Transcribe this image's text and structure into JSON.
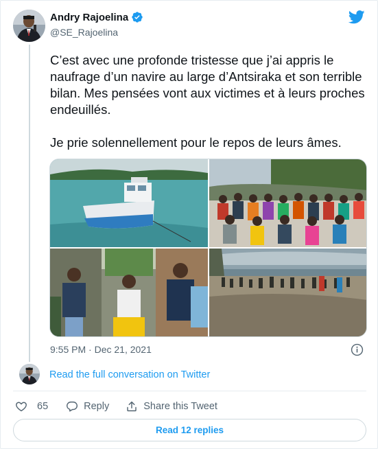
{
  "author": {
    "name": "Andry Rajoelina",
    "handle": "@SE_Rajoelina",
    "verified": true
  },
  "tweet": {
    "paragraphs": [
      "C’est avec une profonde tristesse que j’ai appris le naufrage d’un navire au large d’Antsiraka et son terrible bilan. Mes pensées vont aux victimes et à leurs proches endeuillés.",
      "Je prie solennellement pour le repos de leurs âmes."
    ],
    "timestamp": "9:55 PM · Dec 21, 2021",
    "photos": [
      {
        "icon": "boat-photo"
      },
      {
        "icon": "crowd-photo"
      },
      {
        "icon": "officials-photo"
      },
      {
        "icon": "beach-photo"
      }
    ]
  },
  "conversation": {
    "link_text": "Read the full conversation on Twitter"
  },
  "actions": {
    "likes": "65",
    "reply_label": "Reply",
    "share_label": "Share this Tweet"
  },
  "footer": {
    "replies_button": "Read 12 replies"
  },
  "colors": {
    "accent": "#1d9bf0",
    "secondary_text": "#536471",
    "border": "#cfd9de"
  }
}
